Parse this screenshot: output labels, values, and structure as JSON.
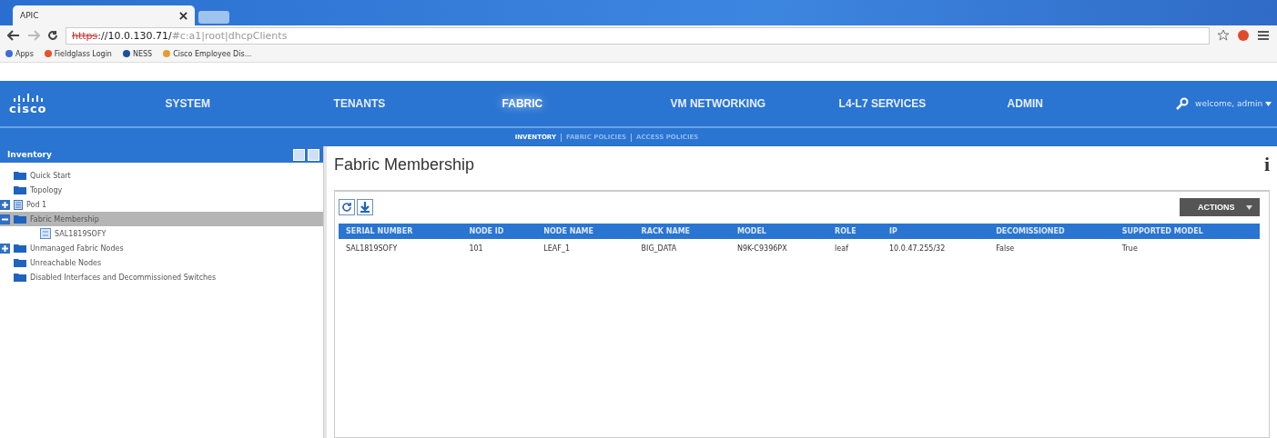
{
  "browser": {
    "tab_title": "APIC",
    "url": {
      "scheme": "https",
      "host": "://10.0.130.71/",
      "path": "#c:a1|root|dhcpClients",
      "insecure": true
    },
    "bookmarks": [
      {
        "kind": "apps",
        "label": "Apps"
      },
      {
        "kind": "fieldglass",
        "label": "Fieldglass Login"
      },
      {
        "kind": "ness",
        "label": "NESS"
      },
      {
        "kind": "folder",
        "label": "Cisco Employee Dis..."
      }
    ]
  },
  "nav": {
    "logo": "cisco",
    "tabs": [
      {
        "label": "SYSTEM",
        "selected": false
      },
      {
        "label": "TENANTS",
        "selected": false
      },
      {
        "label": "FABRIC",
        "selected": true
      },
      {
        "label": "VM NETWORKING",
        "selected": false
      },
      {
        "label": "L4-L7 SERVICES",
        "selected": false
      },
      {
        "label": "ADMIN",
        "selected": false
      }
    ],
    "user": "welcome, admin",
    "subtabs": [
      {
        "label": "INVENTORY",
        "selected": true
      },
      {
        "label": "FABRIC POLICIES",
        "selected": false
      },
      {
        "label": "ACCESS POLICIES",
        "selected": false
      }
    ]
  },
  "sidebar": {
    "title": "Inventory",
    "items": [
      {
        "label": "Quick Start",
        "kind": "folder",
        "selected": false
      },
      {
        "label": "Topology",
        "kind": "folder",
        "selected": false
      },
      {
        "label": "Pod 1",
        "kind": "pod",
        "expanded": false,
        "selected": false
      },
      {
        "label": "Fabric Membership",
        "kind": "folder",
        "expanded": true,
        "selected": true,
        "children": [
          {
            "label": "SAL1819SOFY",
            "kind": "node",
            "selected": false
          }
        ]
      },
      {
        "label": "Unmanaged Fabric Nodes",
        "kind": "folder",
        "expanded": false,
        "selected": false
      },
      {
        "label": "Unreachable Nodes",
        "kind": "folder",
        "selected": false
      },
      {
        "label": "Disabled Interfaces and Decommissioned Switches",
        "kind": "folder",
        "selected": false
      }
    ]
  },
  "main": {
    "title": "Fabric Membership",
    "info": "i",
    "actions": "ACTIONS",
    "table": {
      "columns": [
        "SERIAL NUMBER",
        "NODE ID",
        "NODE NAME",
        "RACK NAME",
        "MODEL",
        "ROLE",
        "IP",
        "DECOMISSIONED",
        "SUPPORTED MODEL"
      ],
      "rows": [
        [
          "SAL1819SOFY",
          "101",
          "LEAF_1",
          "BIG_DATA",
          "N9K-C9396PX",
          "leaf",
          "10.0.47.255/32",
          "False",
          "True"
        ]
      ]
    }
  }
}
